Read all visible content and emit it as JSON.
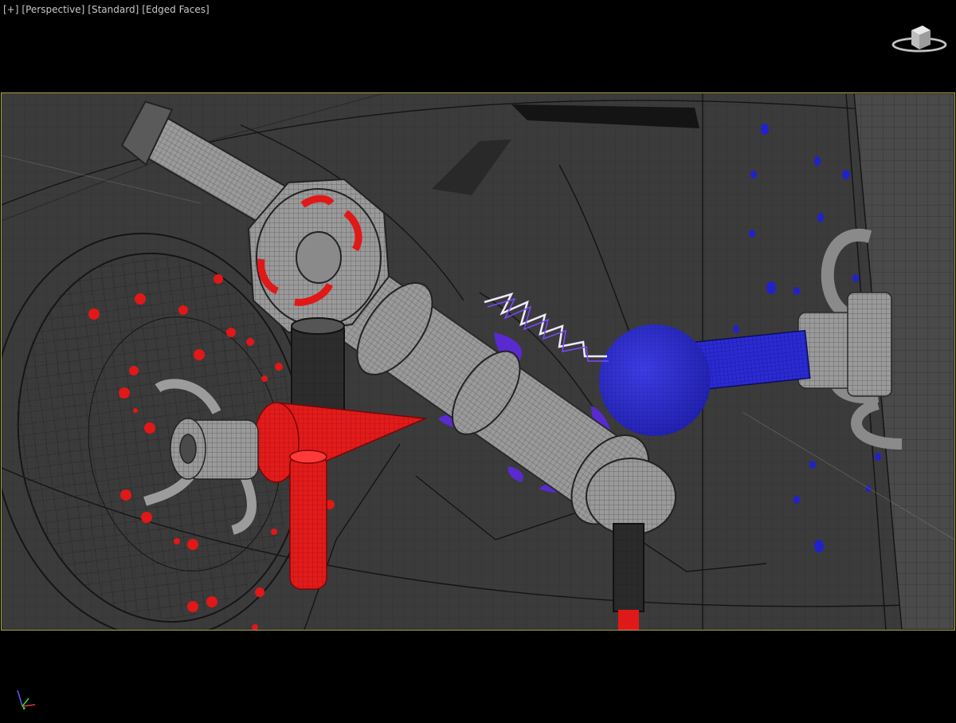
{
  "viewport": {
    "menu": {
      "plus": "[+]",
      "view": "[Perspective]",
      "shading": "[Standard]",
      "display": "[Edged Faces]"
    }
  },
  "icons": {
    "viewcube": "viewcube-icon",
    "axis_gizmo": "axis-tripod-icon"
  },
  "colors": {
    "safe_frame": "#a9a84a",
    "red_object": "#e02020",
    "blue_object": "#2323c8",
    "purple_object": "#5a2bd6",
    "wire": "#111111",
    "mesh": "#7a7a7a"
  }
}
